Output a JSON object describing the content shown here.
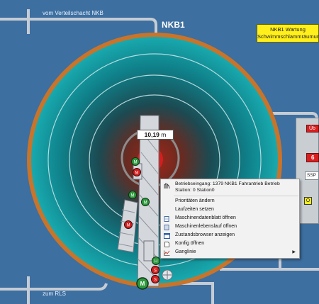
{
  "labels": {
    "inflow": "vom Verteilschacht NKB",
    "outflow": "zum RLS",
    "title": "NKB1",
    "maintenance_line1": "NKB1 Wartung",
    "maintenance_line2": "Schwimmschlammräumung"
  },
  "measurement": {
    "value": "10,19",
    "unit": "m"
  },
  "side_panel": {
    "red_label": "Üb",
    "red_value": "6",
    "ssp_label": "SSP",
    "o_button": "O"
  },
  "motor_icons": [
    "M",
    "M",
    "M",
    "M",
    "M",
    "H",
    "S",
    "S",
    "M"
  ],
  "context_menu": {
    "header_line1": "Betriebseingang: 1379 NKB1 Fahrantrieb Betrieb",
    "header_line2": "Station: 0 Station0",
    "items": [
      {
        "label": "Prioritäten ändern",
        "icon": "blank-icon"
      },
      {
        "label": "Laufzeiten setzen",
        "icon": "blank-icon"
      },
      {
        "label": "Maschinendatenblatt öffnen",
        "icon": "document-icon"
      },
      {
        "label": "Maschinenlebenslauf öffnen",
        "icon": "document-list-icon"
      },
      {
        "label": "Zustandsbrowser anzeigen",
        "icon": "window-icon"
      },
      {
        "label": "Konfig öffnen",
        "icon": "page-icon"
      },
      {
        "label": "Ganglinie",
        "icon": "chart-icon",
        "submenu": true
      }
    ]
  },
  "colors": {
    "background": "#3d6fa0",
    "tank_rim": "#c8742a",
    "tank_water": "#14a0a8",
    "tank_center": "#a1271a",
    "pipe": "#c8ced6",
    "motor_green": "#2d9a3c",
    "motor_red": "#d51f1f",
    "note_yellow": "#ffef1a"
  }
}
